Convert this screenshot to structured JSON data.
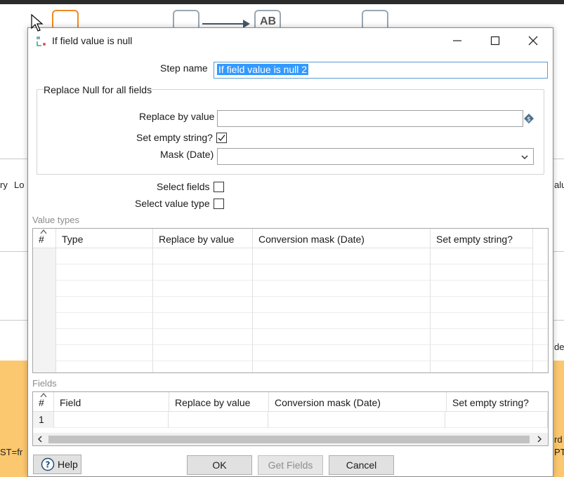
{
  "background": {
    "node_text_ab": "AB",
    "left_texts": [
      "ry",
      "Lo"
    ],
    "right_text_1": "alu",
    "right_text_2": "de",
    "bottom_left_text": "ST=fr",
    "bottom_right_text_1": "rd",
    "bottom_right_text_2": "PT"
  },
  "dialog": {
    "title": "If field value is null",
    "step_name_label": "Step name",
    "step_name_value": "If field value is null 2",
    "group_title": "Replace Null for all fields",
    "replace_by_value_label": "Replace by value",
    "replace_by_value_value": "",
    "set_empty_string_label": "Set empty string?",
    "set_empty_string_checked": true,
    "mask_date_label": "Mask (Date)",
    "mask_date_value": "",
    "select_fields_label": "Select fields",
    "select_fields_checked": false,
    "select_value_type_label": "Select value type",
    "select_value_type_checked": false,
    "value_types": {
      "section_label": "Value types",
      "headers": [
        "#",
        "Type",
        "Replace by value",
        "Conversion mask (Date)",
        "Set empty string?"
      ],
      "rows": [
        [
          "",
          "",
          "",
          "",
          ""
        ],
        [
          "",
          "",
          "",
          "",
          ""
        ],
        [
          "",
          "",
          "",
          "",
          ""
        ],
        [
          "",
          "",
          "",
          "",
          ""
        ],
        [
          "",
          "",
          "",
          "",
          ""
        ],
        [
          "",
          "",
          "",
          "",
          ""
        ],
        [
          "",
          "",
          "",
          "",
          ""
        ],
        [
          "",
          "",
          "",
          "",
          ""
        ]
      ]
    },
    "fields": {
      "section_label": "Fields",
      "headers": [
        "#",
        "Field",
        "Replace by value",
        "Conversion mask (Date)",
        "Set empty string?"
      ],
      "rows": [
        [
          "1",
          "",
          "",
          "",
          ""
        ]
      ]
    },
    "buttons": {
      "help": "Help",
      "ok": "OK",
      "get_fields": "Get Fields",
      "cancel": "Cancel"
    }
  },
  "icons": {
    "minimize": "minimize-icon",
    "maximize": "maximize-icon",
    "close": "close-icon",
    "variable": "variable-diamond-icon",
    "combo": "chevron-down-icon",
    "help": "help-circle-icon"
  },
  "colors": {
    "selection": "#3399ff",
    "canvas_orange": "#fcc86f",
    "focus_border": "#5b9bd5"
  }
}
